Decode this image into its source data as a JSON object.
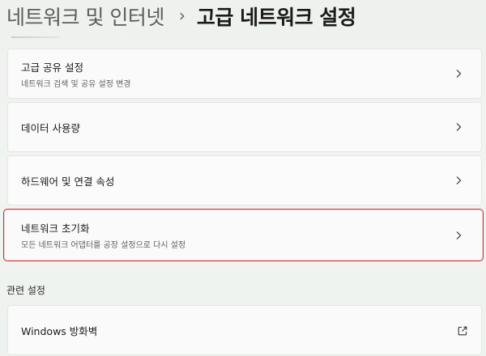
{
  "breadcrumb": {
    "parent": "네트워크 및 인터넷",
    "separator": "›",
    "current": "고급 네트워크 설정"
  },
  "items": [
    {
      "title": "고급 공유 설정",
      "subtitle": "네트워크 검색 및 공유 설정 변경"
    },
    {
      "title": "데이터 사용량"
    },
    {
      "title": "하드웨어 및 연결 속성"
    },
    {
      "title": "네트워크 초기화",
      "subtitle": "모든 네트워크 어댑터를 공장 설정으로 다시 설정"
    }
  ],
  "related": {
    "label": "관련 설정",
    "items": [
      {
        "title": "Windows 방화벽"
      }
    ]
  },
  "colors": {
    "highlight_border": "#d12b2b",
    "background": "#eef1ee",
    "card": "#fbfbfb"
  },
  "icons": {
    "chevron": "chevron-right-icon",
    "external": "open-external-icon"
  }
}
